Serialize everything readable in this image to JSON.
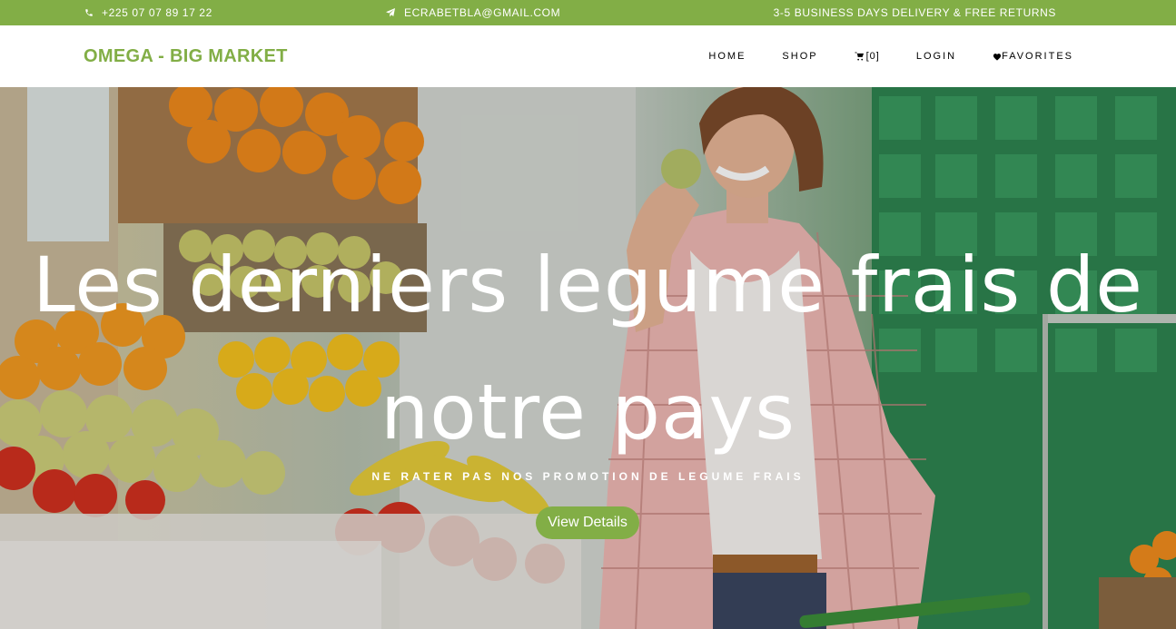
{
  "topbar": {
    "phone": "+225 07 07 89 17 22",
    "email": "ecrabetbla@gmail.com",
    "delivery": "3-5 Business days delivery & Free Returns",
    "phone_icon": "phone-icon",
    "email_icon": "paper-plane-icon"
  },
  "brand": {
    "name": "OMEGA - BIG MARKET"
  },
  "nav": {
    "home": "HOME",
    "shop": "SHOP",
    "cart_count": "[0]",
    "cart_icon": "cart-icon",
    "login": "LOGIN",
    "favorites": "FAVORITES",
    "favorites_icon": "heart-icon"
  },
  "hero": {
    "title": "Les derniers legume frais de notre pays",
    "subtitle": "NE RATER PAS NOS PROMOTION DE LEGUME FRAIS",
    "button": "View Details"
  },
  "colors": {
    "accent": "#82ae46",
    "text_dark": "#000000",
    "white": "#ffffff"
  }
}
